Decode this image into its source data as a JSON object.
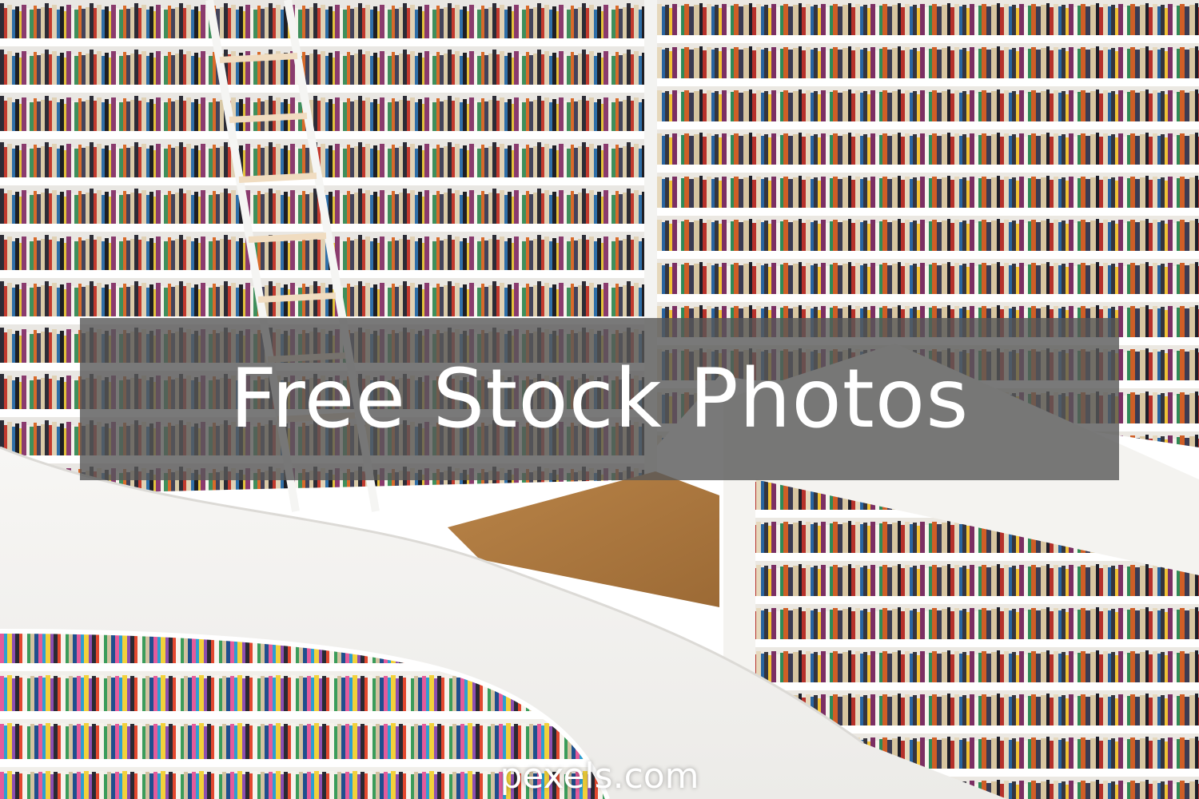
{
  "banner": {
    "title": "Free Stock Photos"
  },
  "watermark": {
    "text": "pexels.com"
  },
  "colors": {
    "banner_overlay": "#585858",
    "text": "#ffffff",
    "floor": "#a8753f",
    "shelf": "#f2f2f2"
  }
}
